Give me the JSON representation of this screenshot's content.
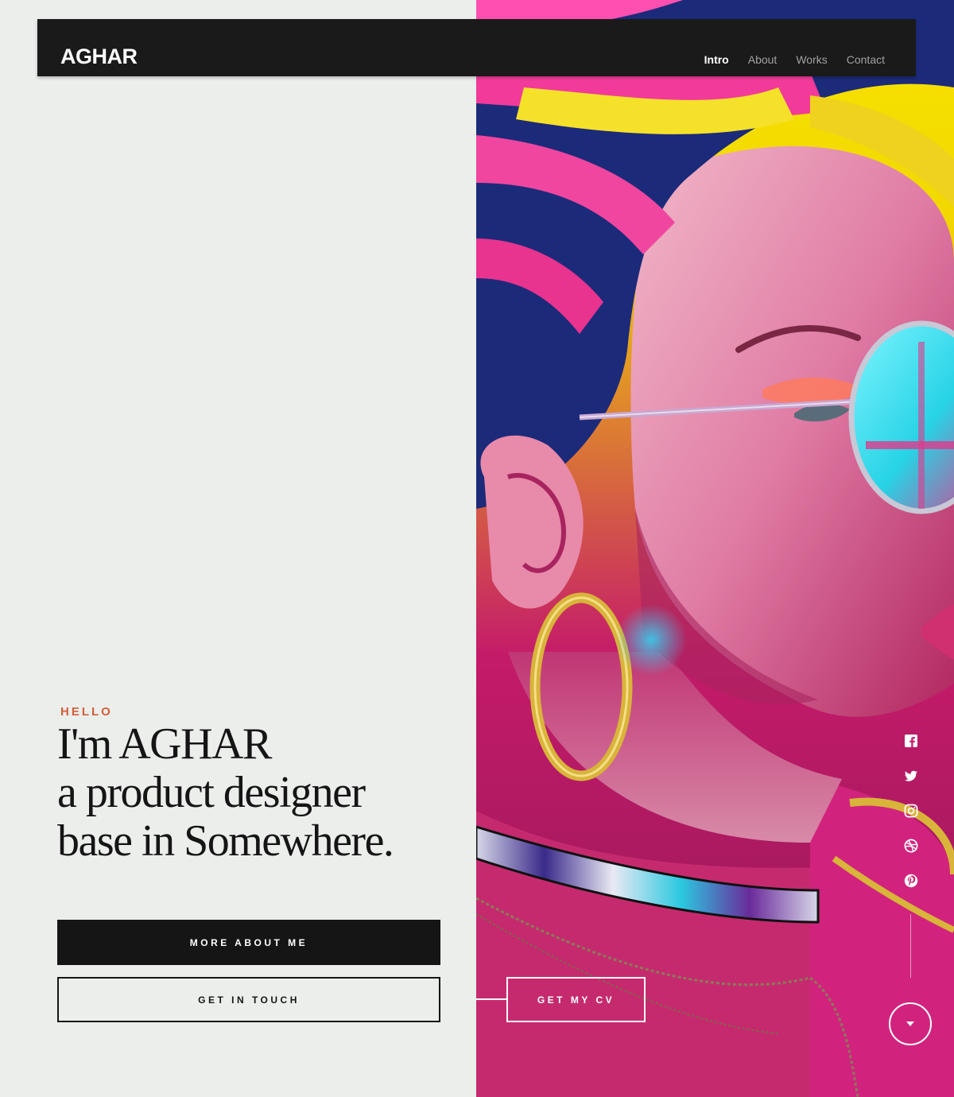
{
  "brand": {
    "logo_text": "AGHAR"
  },
  "nav": {
    "items": [
      {
        "label": "Intro",
        "active": true
      },
      {
        "label": "About",
        "active": false
      },
      {
        "label": "Works",
        "active": false
      },
      {
        "label": "Contact",
        "active": false
      }
    ]
  },
  "intro": {
    "eyebrow": "HELLO",
    "heading_lines": [
      "I'm AGHAR",
      "a product designer",
      "base in Somewhere."
    ]
  },
  "buttons": {
    "primary": "MORE ABOUT ME",
    "secondary": "GET IN TOUCH",
    "cv": "GET MY CV"
  },
  "social": {
    "icons": [
      "facebook-icon",
      "twitter-icon",
      "instagram-icon",
      "dribbble-icon",
      "pinterest-icon"
    ]
  },
  "scroll": {
    "icon": "chevron-down-icon"
  },
  "colors": {
    "accent": "#d35f3a",
    "header_bg": "#1a1a1a",
    "panel_bg": "#eceeec",
    "text_dark": "#151515",
    "hero_magenta": "#d81b7a",
    "hero_yellow": "#f7e300",
    "hero_cyan": "#2fd0e0"
  }
}
